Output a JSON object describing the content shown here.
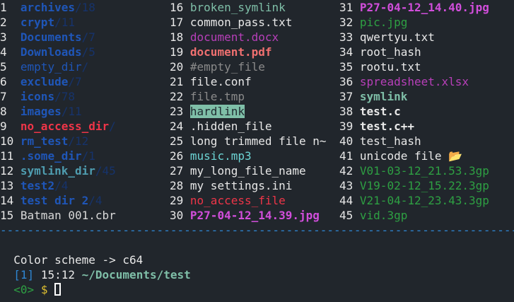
{
  "files": [
    {
      "num": "1",
      "name": "archives",
      "suffix": "/18",
      "color": "#1f56b8",
      "bold": true
    },
    {
      "num": "2",
      "name": "crypt",
      "suffix": "/11",
      "color": "#1f56b8",
      "bold": true
    },
    {
      "num": "3",
      "name": "Documents",
      "suffix": "/7",
      "color": "#1f56b8",
      "bold": true
    },
    {
      "num": "4",
      "name": "Downloads",
      "suffix": "/5",
      "color": "#1f56b8",
      "bold": true
    },
    {
      "num": "5",
      "name": "empty_dir",
      "suffix": "/",
      "color": "#1f56b8",
      "bold": false
    },
    {
      "num": "6",
      "name": "exclude",
      "suffix": "/7",
      "color": "#1f56b8",
      "bold": true
    },
    {
      "num": "7",
      "name": "icons",
      "suffix": "/78",
      "color": "#1f56b8",
      "bold": true
    },
    {
      "num": "8",
      "name": "images",
      "suffix": "/11",
      "color": "#1f56b8",
      "bold": true
    },
    {
      "num": "9",
      "name": "no_access_dir",
      "suffix": "/",
      "color": "#ee3548",
      "bold": true
    },
    {
      "num": "10",
      "name": "rm_test",
      "suffix": "/12",
      "color": "#1f56b8",
      "bold": true
    },
    {
      "num": "11",
      "name": ".some_dir",
      "suffix": "/1",
      "color": "#1f56b8",
      "bold": true
    },
    {
      "num": "12",
      "name": "symlink_dir",
      "suffix": "/45",
      "color": "#4f9db0",
      "bold": true
    },
    {
      "num": "13",
      "name": "test2",
      "suffix": "/4",
      "color": "#1f56b8",
      "bold": true
    },
    {
      "num": "14",
      "name": "test dir 2",
      "suffix": "/4",
      "color": "#1f56b8",
      "bold": true
    },
    {
      "num": "15",
      "name": "Batman 001.cbr",
      "suffix": "",
      "color": "#d8d8d8",
      "bold": false
    },
    {
      "num": "16",
      "name": "broken_symlink",
      "suffix": "",
      "color": "#7fbfa8",
      "bold": false
    },
    {
      "num": "17",
      "name": "common_pass.txt",
      "suffix": "",
      "color": "#e8e8e8",
      "bold": false
    },
    {
      "num": "18",
      "name": "document.docx",
      "suffix": "",
      "color": "#b73fb9",
      "bold": false
    },
    {
      "num": "19",
      "name": "document.pdf",
      "suffix": "",
      "color": "#f07070",
      "bold": true
    },
    {
      "num": "20",
      "name": "#empty_file",
      "suffix": "",
      "color": "#8a8a8a",
      "bold": false
    },
    {
      "num": "21",
      "name": "file.conf",
      "suffix": "",
      "color": "#e8e8e8",
      "bold": false
    },
    {
      "num": "22",
      "name": "file.tmp",
      "suffix": "",
      "color": "#8a8a8a",
      "bold": false
    },
    {
      "num": "23",
      "name": "hardlink",
      "suffix": "",
      "color": "#1f2a30",
      "bold": false,
      "highlight": true
    },
    {
      "num": "24",
      "name": ".hidden_file",
      "suffix": "",
      "color": "#e8e8e8",
      "bold": false
    },
    {
      "num": "25",
      "name": "long trimmed file n~",
      "suffix": "",
      "color": "#e8e8e8",
      "bold": false
    },
    {
      "num": "26",
      "name": "music.mp3",
      "suffix": "",
      "color": "#6cd4d4",
      "bold": false
    },
    {
      "num": "27",
      "name": "my_long_file_name",
      "suffix": "",
      "color": "#e8e8e8",
      "bold": false
    },
    {
      "num": "28",
      "name": "my settings.ini",
      "suffix": "",
      "color": "#e8e8e8",
      "bold": false
    },
    {
      "num": "29",
      "name": "no_access_file",
      "suffix": "",
      "color": "#ee3548",
      "bold": false
    },
    {
      "num": "30",
      "name": "P27-04-12_14.39.jpg",
      "suffix": "",
      "color": "#d14edb",
      "bold": true
    },
    {
      "num": "31",
      "name": "P27-04-12_14.40.jpg",
      "suffix": "",
      "color": "#d14edb",
      "bold": true
    },
    {
      "num": "32",
      "name": "pic.jpg",
      "suffix": "",
      "color": "#2ea043",
      "bold": false
    },
    {
      "num": "33",
      "name": "qwertyu.txt",
      "suffix": "",
      "color": "#e8e8e8",
      "bold": false
    },
    {
      "num": "34",
      "name": "root_hash",
      "suffix": "",
      "color": "#e8e8e8",
      "bold": false
    },
    {
      "num": "35",
      "name": "rootu.txt",
      "suffix": "",
      "color": "#e8e8e8",
      "bold": false
    },
    {
      "num": "36",
      "name": "spreadsheet.xlsx",
      "suffix": "",
      "color": "#b73fb9",
      "bold": false
    },
    {
      "num": "37",
      "name": "symlink",
      "suffix": "",
      "color": "#7fbfa8",
      "bold": true
    },
    {
      "num": "38",
      "name": "test.c",
      "suffix": "",
      "color": "#e8e8e8",
      "bold": true
    },
    {
      "num": "39",
      "name": "test.c++",
      "suffix": "",
      "color": "#e8e8e8",
      "bold": true
    },
    {
      "num": "40",
      "name": "test_hash",
      "suffix": "",
      "color": "#e8e8e8",
      "bold": false
    },
    {
      "num": "41",
      "name": "unicode file 📂",
      "suffix": "",
      "color": "#e8e8e8",
      "bold": false
    },
    {
      "num": "42",
      "name": "V01-03-12_21.53.3gp",
      "suffix": "",
      "color": "#2ea043",
      "bold": false
    },
    {
      "num": "43",
      "name": "V19-02-12_15.22.3gp",
      "suffix": "",
      "color": "#2ea043",
      "bold": false
    },
    {
      "num": "44",
      "name": "V21-04-12_23.43.3gp",
      "suffix": "",
      "color": "#2ea043",
      "bold": false
    },
    {
      "num": "45",
      "name": "vid.3gp",
      "suffix": "",
      "color": "#2ea043",
      "bold": false
    }
  ],
  "separator": "------------------------------------------------------------------------------------------",
  "status": {
    "message": "Color scheme -> c64",
    "position_prefix": "[1]",
    "time": "15:12",
    "path": "~/Documents/test",
    "prompt_count": "<0>",
    "prompt_symbol": "$"
  },
  "colors": {
    "background": "#21262c",
    "separator": "#2f86d2",
    "dir": "#1f56b8",
    "status_blue": "#2f86d2",
    "status_path": "#7fbfa8",
    "prompt_green": "#2ea043",
    "prompt_yellow": "#e0c030"
  }
}
